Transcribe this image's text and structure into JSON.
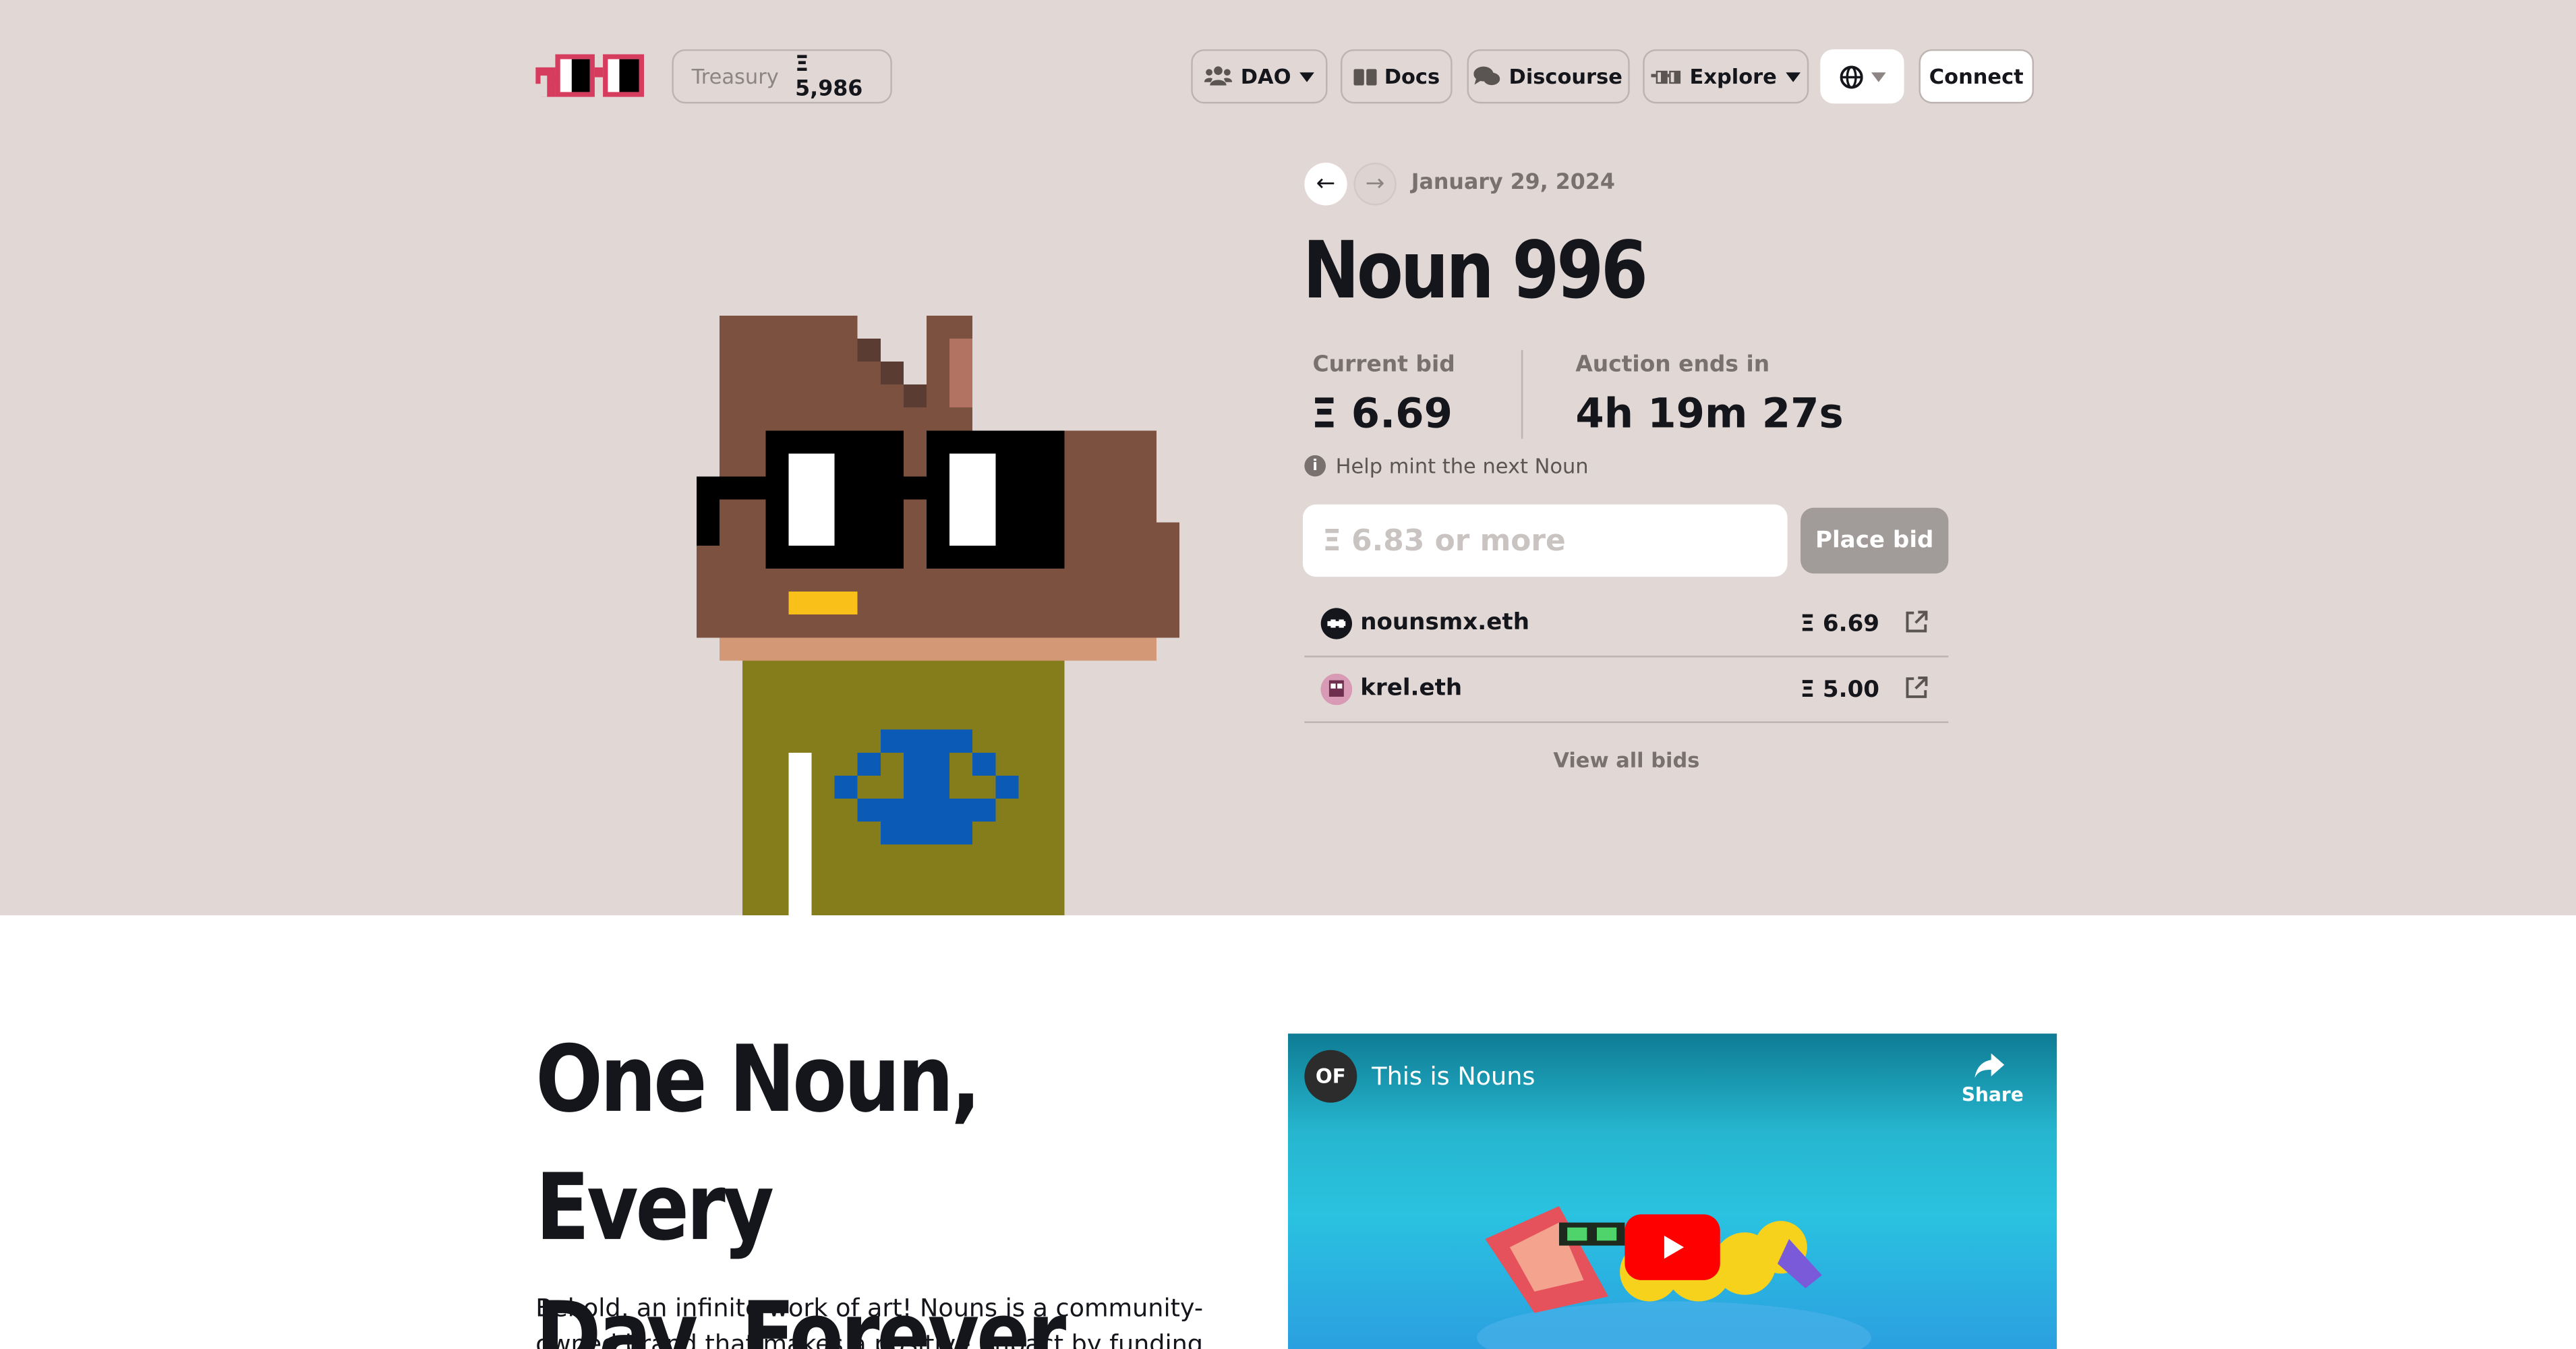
{
  "nav": {
    "treasury_label": "Treasury",
    "treasury_value": "Ξ 5,986",
    "dao_label": "DAO",
    "docs_label": "Docs",
    "discourse_label": "Discourse",
    "explore_label": "Explore",
    "connect_label": "Connect"
  },
  "auction": {
    "date": "January 29, 2024",
    "prev_arrow": "←",
    "next_arrow": "→",
    "title": "Noun 996",
    "current_bid_label": "Current bid",
    "current_bid_value": "Ξ 6.69",
    "ends_label": "Auction ends in",
    "ends_value": "4h 19m 27s",
    "help_text": "Help mint the next Noun",
    "bid_placeholder": "Ξ 6.83 or more",
    "place_bid_label": "Place bid",
    "bids": [
      {
        "name": "nounsmx.eth",
        "amount": "Ξ 6.69"
      },
      {
        "name": "krel.eth",
        "amount": "Ξ 5.00"
      }
    ],
    "view_all_label": "View all bids"
  },
  "about": {
    "headline_line1": "One Noun, Every",
    "headline_line2": "Day, Forever.",
    "body_line1": "Behold, an infinite work of art! Nouns is a community-",
    "body_line2": "owned brand that makes a positive impact by funding ideas"
  },
  "video": {
    "channel_badge": "OF",
    "title": "This is Nouns",
    "share_label": "Share"
  },
  "colors": {
    "hero_bg": "#e1d7d5",
    "logo_red": "#d63c5e",
    "noun_head": "#7d5140",
    "noun_body": "#857c1c",
    "noun_accessory": "#0b5bb6",
    "glasses": "#000000"
  },
  "icons": {
    "dao": "users-icon",
    "docs": "book-icon",
    "discourse": "comments-icon",
    "explore": "noggles-icon",
    "language": "globe-icon",
    "info": "info-icon",
    "external": "external-link-icon",
    "play": "youtube-play-icon",
    "share": "share-arrow-icon"
  }
}
